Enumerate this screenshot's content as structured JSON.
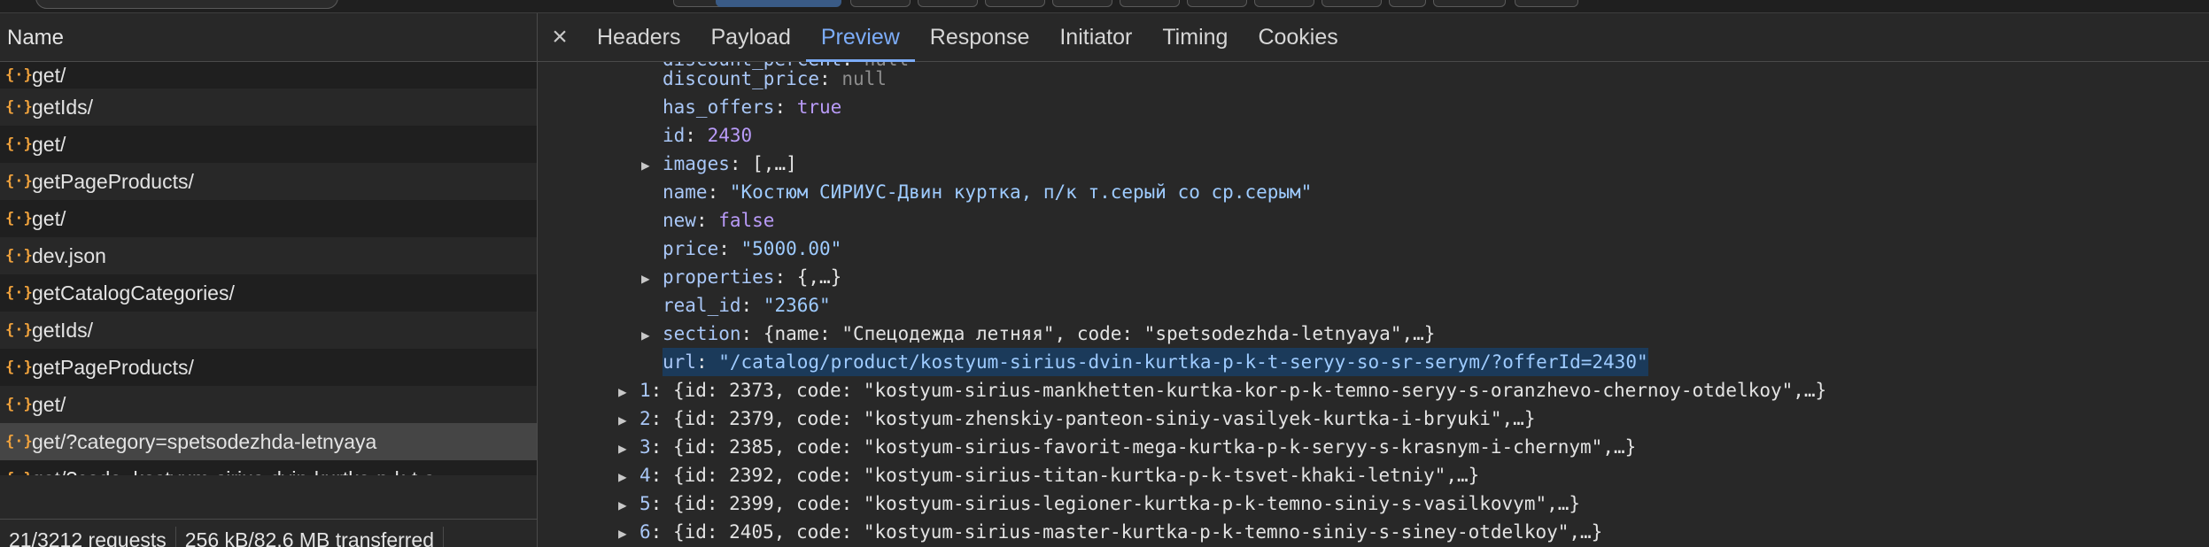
{
  "left": {
    "column_header": "Name",
    "requests": [
      {
        "name": "get/"
      },
      {
        "name": "getIds/"
      },
      {
        "name": "get/"
      },
      {
        "name": "getPageProducts/"
      },
      {
        "name": "get/"
      },
      {
        "name": "dev.json"
      },
      {
        "name": "getCatalogCategories/"
      },
      {
        "name": "getIds/"
      },
      {
        "name": "getPageProducts/"
      },
      {
        "name": "get/"
      },
      {
        "name": "get/?category=spetsodezhda-letnyaya"
      },
      {
        "name": "get/?code=kostyum-sirius-dvin-kurtka-p-k-t-s..."
      }
    ],
    "request_icon": "{·}",
    "status": {
      "requests": "21/3212 requests",
      "transferred": "256 kB/82.6 MB transferred"
    }
  },
  "tabs": {
    "close_icon": "×",
    "items": [
      {
        "label": "Headers"
      },
      {
        "label": "Payload"
      },
      {
        "label": "Preview",
        "active": true
      },
      {
        "label": "Response"
      },
      {
        "label": "Initiator"
      },
      {
        "label": "Timing"
      },
      {
        "label": "Cookies"
      }
    ]
  },
  "preview": {
    "l0": {
      "key": "discount_percent",
      "value": "null"
    },
    "l1": {
      "key": "discount_price",
      "value": "null"
    },
    "l2": {
      "key": "has_offers",
      "value": "true"
    },
    "l3": {
      "key": "id",
      "value": "2430"
    },
    "l4": {
      "key": "images",
      "value": "[,…]"
    },
    "l5": {
      "key": "name",
      "value": "\"Костюм СИРИУС-Двин куртка, п/к т.серый со ср.серым\""
    },
    "l6": {
      "key": "new",
      "value": "false"
    },
    "l7": {
      "key": "price",
      "value": "\"5000.00\""
    },
    "l8": {
      "key": "properties",
      "value": "{,…}"
    },
    "l9": {
      "key": "real_id",
      "value": "\"2366\""
    },
    "l10": {
      "key": "section",
      "value": "{name: \"Спецодежда летняя\", code: \"spetsodezhda-letnyaya\",…}"
    },
    "l11": {
      "key": "url",
      "value": "\"/catalog/product/kostyum-sirius-dvin-kurtka-p-k-t-seryy-so-sr-serym/?offerId=2430\""
    },
    "items": [
      {
        "index": "1",
        "text": "{id: 2373, code: \"kostyum-sirius-mankhetten-kurtka-kor-p-k-temno-seryy-s-oranzhevo-chernoy-otdelkoy\",…}"
      },
      {
        "index": "2",
        "text": "{id: 2379, code: \"kostyum-zhenskiy-panteon-siniy-vasilyek-kurtka-i-bryuki\",…}"
      },
      {
        "index": "3",
        "text": "{id: 2385, code: \"kostyum-sirius-favorit-mega-kurtka-p-k-seryy-s-krasnym-i-chernym\",…}"
      },
      {
        "index": "4",
        "text": "{id: 2392, code: \"kostyum-sirius-titan-kurtka-p-k-tsvet-khaki-letniy\",…}"
      },
      {
        "index": "5",
        "text": "{id: 2399, code: \"kostyum-sirius-legioner-kurtka-p-k-temno-siniy-s-vasilkovym\",…}"
      },
      {
        "index": "6",
        "text": "{id: 2405, code: \"kostyum-sirius-master-kurtka-p-k-temno-siniy-s-siney-otdelkoy\",…}"
      }
    ]
  }
}
